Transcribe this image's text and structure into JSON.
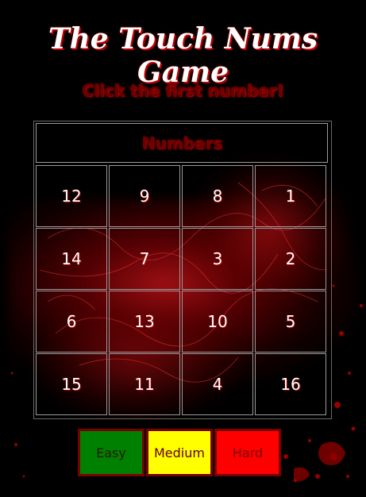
{
  "title": "The Touch Nums Game",
  "status": "Click the first number!",
  "board": {
    "header": "Numbers",
    "numbers": [
      12,
      9,
      8,
      1,
      14,
      7,
      3,
      2,
      6,
      13,
      10,
      5,
      15,
      11,
      4,
      16
    ]
  },
  "levels": [
    {
      "label": "Easy",
      "color": "#008000",
      "text_color": "#2a1a00"
    },
    {
      "label": "Medium",
      "color": "#ffff00",
      "text_color": "#600000"
    },
    {
      "label": "Hard",
      "color": "#ff0000",
      "text_color": "#7a0000"
    }
  ],
  "colors": {
    "background": "#000000",
    "accent": "#c00000"
  }
}
